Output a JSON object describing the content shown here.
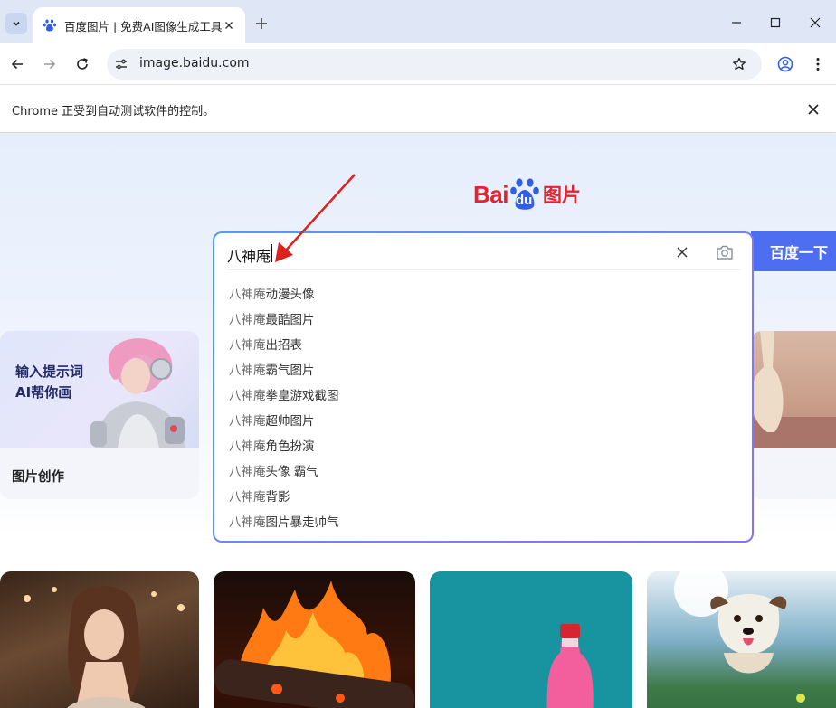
{
  "browser": {
    "tab": {
      "title": "百度图片 | 免费AI图像生成工具",
      "favicon": "baidu-paw-icon"
    },
    "address": {
      "url": "image.baidu.com"
    },
    "infobar": {
      "message": "Chrome 正受到自动测试软件的控制。"
    }
  },
  "page": {
    "logo": {
      "text_bai": "Bai",
      "text_du": "du",
      "text_tupian": "图片"
    },
    "search": {
      "query": "八神庵",
      "button_label": "百度一下",
      "suggestions": [
        {
          "q": "八神庵",
          "rest": "动漫头像"
        },
        {
          "q": "八神庵",
          "rest": "最酷图片"
        },
        {
          "q": "八神庵",
          "rest": "出招表"
        },
        {
          "q": "八神庵",
          "rest": "霸气图片"
        },
        {
          "q": "八神庵",
          "rest": "拳皇游戏截图"
        },
        {
          "q": "八神庵",
          "rest": "超帅图片"
        },
        {
          "q": "八神庵",
          "rest": "角色扮演"
        },
        {
          "q": "八神庵",
          "rest": "头像 霸气"
        },
        {
          "q": "八神庵",
          "rest": "背影"
        },
        {
          "q": "八神庵",
          "rest": "图片暴走帅气"
        }
      ]
    },
    "ai_card": {
      "line1": "输入提示词",
      "line2": "AI帮你画",
      "label": "图片创作"
    }
  },
  "colors": {
    "brand_red": "#e8222d",
    "button_blue": "#4e6ef2",
    "arrow_red": "#e0201b"
  }
}
